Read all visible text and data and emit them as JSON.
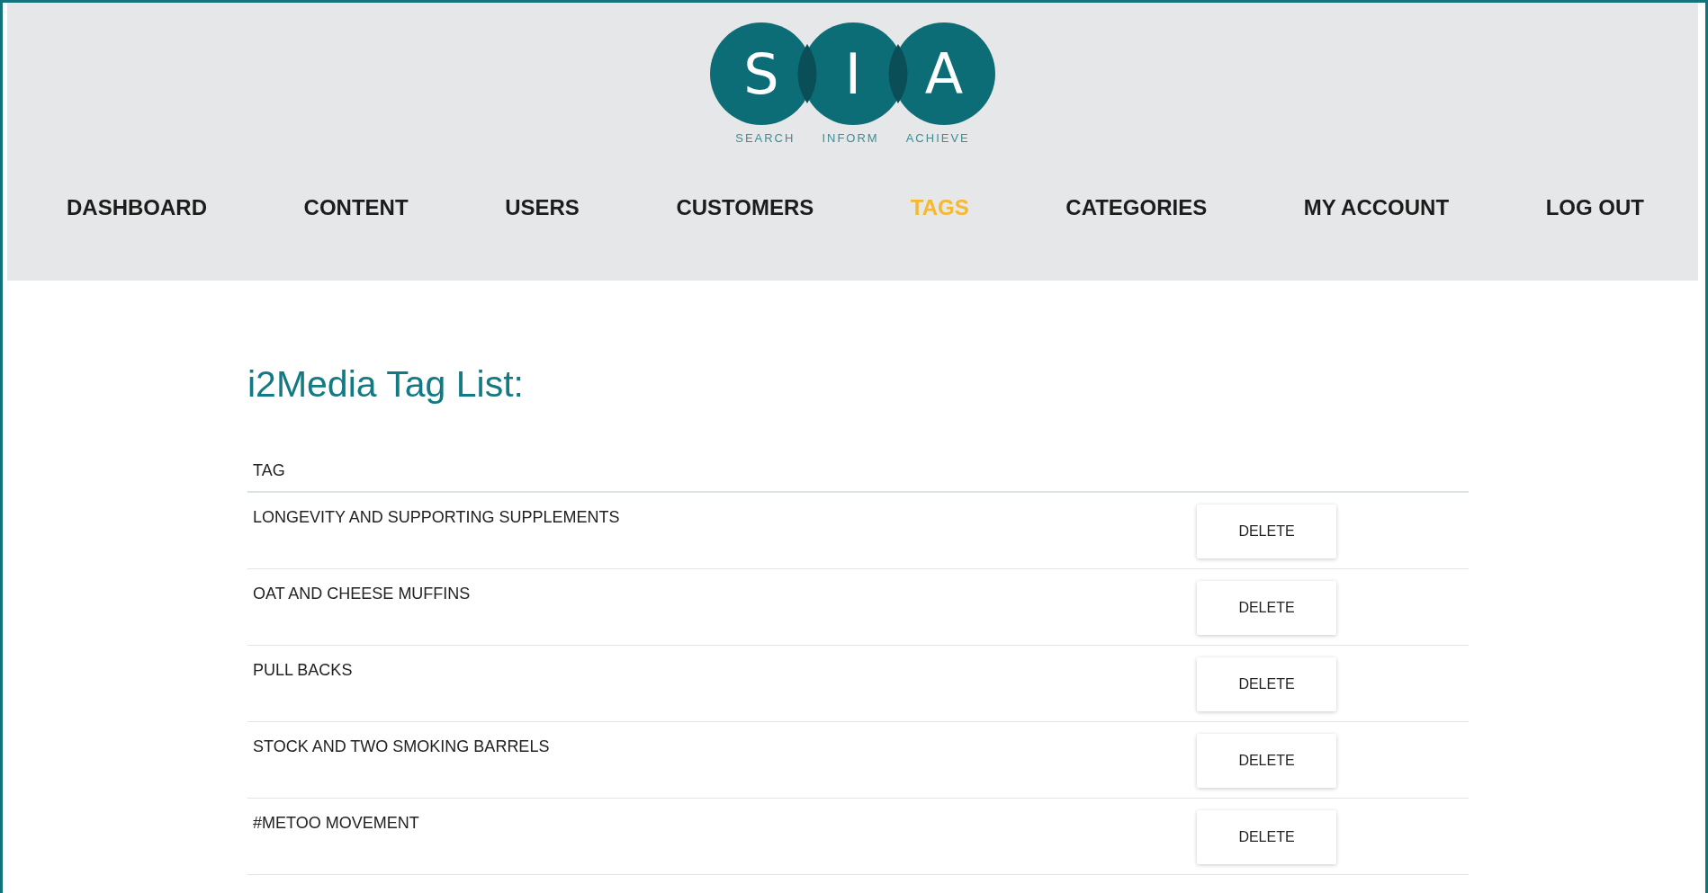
{
  "logo": {
    "letters": [
      "S",
      "I",
      "A"
    ],
    "taglines": [
      "SEARCH",
      "INFORM",
      "ACHIEVE"
    ]
  },
  "nav": [
    {
      "label": "DASHBOARD",
      "selected": false
    },
    {
      "label": "CONTENT",
      "selected": false
    },
    {
      "label": "USERS",
      "selected": false
    },
    {
      "label": "CUSTOMERS",
      "selected": false
    },
    {
      "label": "TAGS",
      "selected": true
    },
    {
      "label": "CATEGORIES",
      "selected": false
    },
    {
      "label": "MY ACCOUNT",
      "selected": false
    },
    {
      "label": "LOG OUT",
      "selected": false
    }
  ],
  "page_title": "i2Media Tag List:",
  "table": {
    "columns": [
      "TAG"
    ],
    "rows": [
      {
        "tag": "LONGEVITY AND SUPPORTING SUPPLEMENTS",
        "action": "DELETE"
      },
      {
        "tag": "OAT AND CHEESE MUFFINS",
        "action": "DELETE"
      },
      {
        "tag": "PULL BACKS",
        "action": "DELETE"
      },
      {
        "tag": "STOCK AND TWO SMOKING BARRELS",
        "action": "DELETE"
      },
      {
        "tag": "#METOO MOVEMENT",
        "action": "DELETE"
      }
    ]
  }
}
